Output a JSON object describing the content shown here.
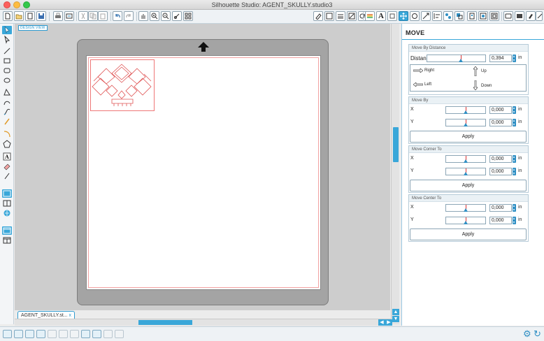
{
  "window": {
    "title": "Silhouette Studio: AGENT_SKULLY.studio3"
  },
  "workspace": {
    "tag": "DESIGN VIEW"
  },
  "doc_tab": {
    "label": "AGENT_SKULLY.st...",
    "close": "x"
  },
  "panel": {
    "title": "MOVE",
    "move_by_distance": {
      "header": "Move By Distance",
      "label": "Distance",
      "value": "0,394",
      "unit": "in",
      "directions": {
        "right": "Right",
        "up": "Up",
        "left": "Left",
        "down": "Down"
      }
    },
    "move_by": {
      "header": "Move By",
      "x_label": "X",
      "x_value": "0,000",
      "x_unit": "in",
      "y_label": "Y",
      "y_value": "0,000",
      "y_unit": "in",
      "apply": "Apply"
    },
    "move_corner_to": {
      "header": "Move Corner To",
      "x_label": "X",
      "x_value": "0,000",
      "x_unit": "in",
      "y_label": "Y",
      "y_value": "0,000",
      "y_unit": "in",
      "apply": "Apply"
    },
    "move_center_to": {
      "header": "Move Center To",
      "x_label": "X",
      "x_value": "0,000",
      "x_unit": "in",
      "y_label": "Y",
      "y_value": "0,000",
      "y_unit": "in",
      "apply": "Apply"
    }
  },
  "toolbar": {
    "left_icons": [
      "new-document-icon",
      "open-icon",
      "open-library-icon",
      "save-icon",
      "print-icon",
      "send-to-cutter-icon",
      "cut-icon",
      "copy-icon",
      "paste-icon",
      "delete-icon",
      "undo-icon",
      "redo-icon",
      "pan-icon",
      "zoom-in-icon",
      "zoom-out-icon",
      "zoom-box-icon",
      "zoom-drag-icon",
      "fit-to-page-icon"
    ],
    "right_icons": [
      "fill-color-icon",
      "line-color-icon",
      "line-style-icon",
      "fill-pattern-icon",
      "fill-gradient-icon",
      "shadow-icon",
      "stripe-icon",
      "text-style-icon",
      "transform-icon",
      "move-icon",
      "rotate-icon",
      "scale-icon",
      "align-icon",
      "replicate-icon",
      "modify-icon",
      "knife-icon",
      "trace-icon",
      "offset-icon",
      "page-setup-icon",
      "registration-icon",
      "cut-settings-icon",
      "send-icon"
    ]
  },
  "colors": {
    "accent": "#39a7d9",
    "cut_line": "#e77777",
    "mat": "#a4a4a4"
  }
}
